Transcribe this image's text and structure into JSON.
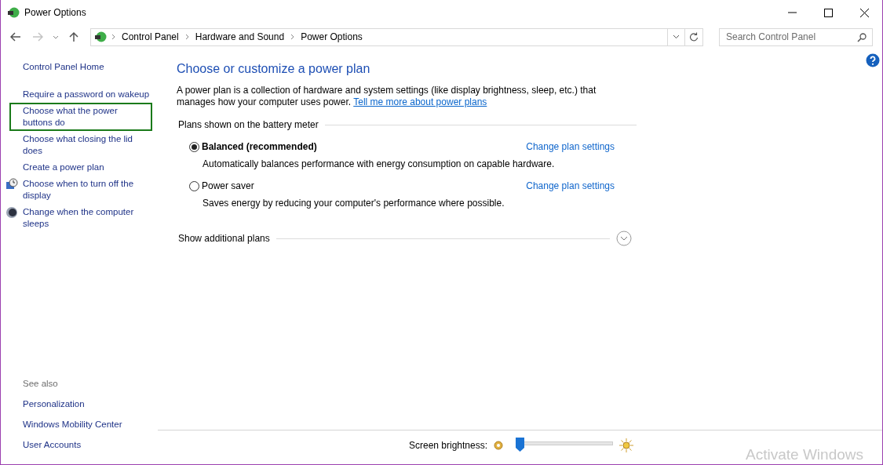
{
  "window": {
    "title": "Power Options"
  },
  "breadcrumb": [
    "Control Panel",
    "Hardware and Sound",
    "Power Options"
  ],
  "search": {
    "placeholder": "Search Control Panel"
  },
  "sidebar": {
    "items": [
      {
        "label": "Control Panel Home",
        "kind": "home",
        "highlighted": false
      },
      {
        "label": "Require a password on wakeup",
        "kind": "link",
        "highlighted": false
      },
      {
        "label": "Choose what the power buttons do",
        "kind": "link",
        "highlighted": true
      },
      {
        "label": "Choose what closing the lid does",
        "kind": "link",
        "highlighted": false
      },
      {
        "label": "Create a power plan",
        "kind": "link",
        "highlighted": false
      },
      {
        "label": "Choose when to turn off the display",
        "kind": "display",
        "highlighted": false
      },
      {
        "label": "Change when the computer sleeps",
        "kind": "sleep",
        "highlighted": false
      }
    ],
    "see_also": {
      "heading": "See also",
      "items": [
        "Personalization",
        "Windows Mobility Center",
        "User Accounts"
      ]
    }
  },
  "content": {
    "title": "Choose or customize a power plan",
    "intro": "A power plan is a collection of hardware and system settings (like display brightness, sleep, etc.) that manages how your computer uses power.",
    "intro_link": "Tell me more about power plans",
    "group_label": "Plans shown on the battery meter",
    "plans": [
      {
        "name": "Balanced (recommended)",
        "selected": true,
        "description": "Automatically balances performance with energy consumption on capable hardware.",
        "action": "Change plan settings"
      },
      {
        "name": "Power saver",
        "selected": false,
        "description": "Saves energy by reducing your computer's performance where possible.",
        "action": "Change plan settings"
      }
    ],
    "more_label": "Show additional plans"
  },
  "brightness": {
    "label": "Screen brightness:",
    "level": 0
  },
  "activation": "Activate Windows"
}
